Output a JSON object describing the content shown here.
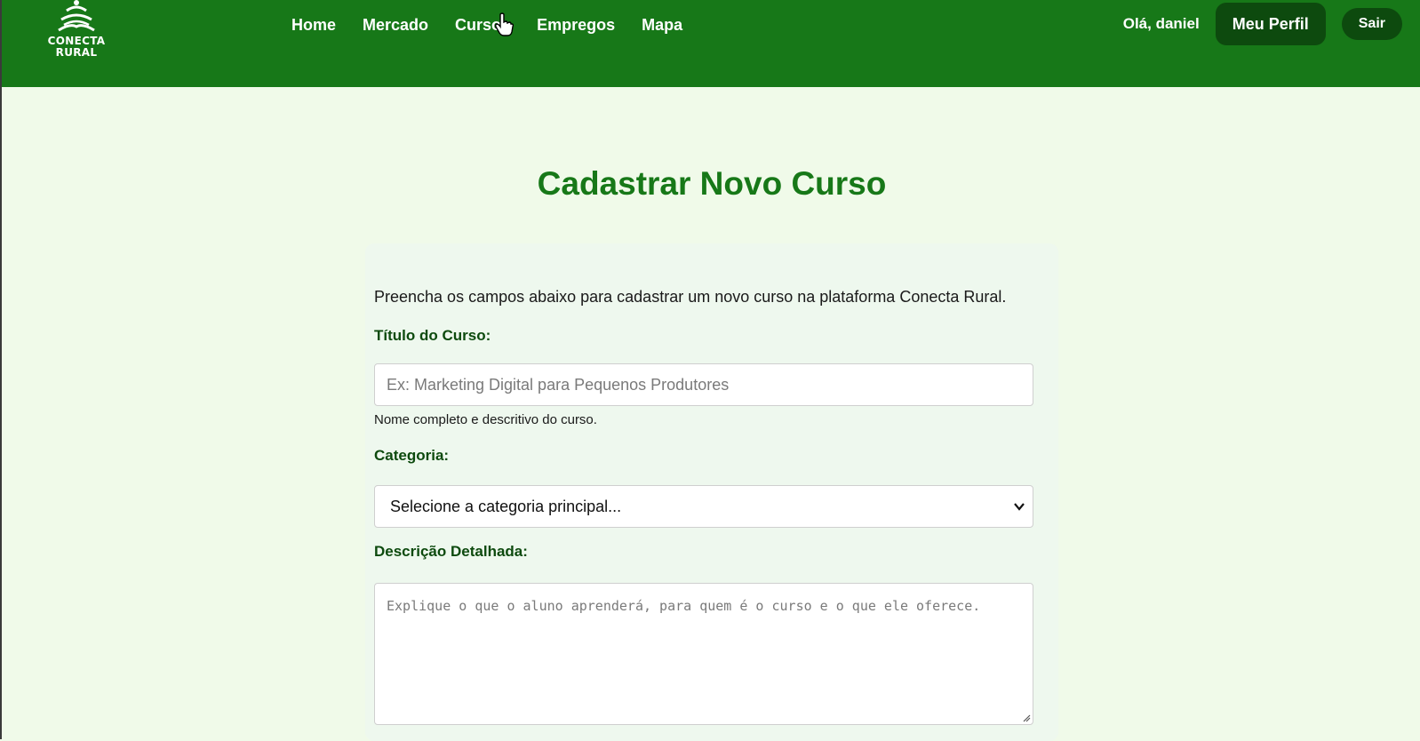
{
  "header": {
    "logo_text_line1": "CONECTA",
    "logo_text_line2": "RURAL",
    "nav": [
      {
        "label": "Home"
      },
      {
        "label": "Mercado"
      },
      {
        "label": "Cursos"
      },
      {
        "label": "Empregos"
      },
      {
        "label": "Mapa"
      }
    ],
    "greeting": "Olá, daniel",
    "profile_button": "Meu Perfil",
    "exit_button": "Sair"
  },
  "page": {
    "title": "Cadastrar Novo Curso",
    "intro": "Preencha os campos abaixo para cadastrar um novo curso na plataforma Conecta Rural."
  },
  "form": {
    "title_label": "Título do Curso:",
    "title_placeholder": "Ex: Marketing Digital para Pequenos Produtores",
    "title_help": "Nome completo e descritivo do curso.",
    "category_label": "Categoria:",
    "category_selected": "Selecione a categoria principal...",
    "description_label": "Descrição Detalhada:",
    "description_placeholder": "Explique o que o aluno aprenderá, para quem é o curso e o que ele oferece."
  },
  "colors": {
    "header_bg": "#177818",
    "dark_button": "#0d4a0e",
    "page_bg": "#f0fae9",
    "title": "#177818"
  }
}
